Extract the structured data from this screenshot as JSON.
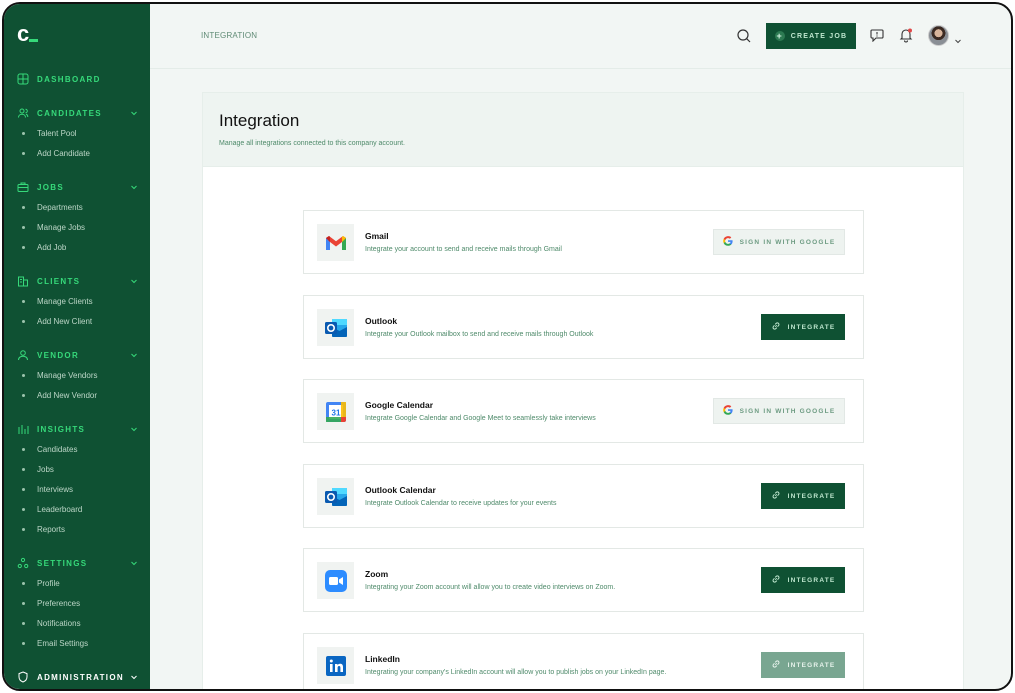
{
  "brand": {
    "logo_text": "c"
  },
  "sidebar": {
    "sections": [
      {
        "label": "DASHBOARD",
        "icon": "dashboard-icon",
        "items": []
      },
      {
        "label": "CANDIDATES",
        "icon": "candidates-icon",
        "items": [
          "Talent Pool",
          "Add Candidate"
        ]
      },
      {
        "label": "JOBS",
        "icon": "briefcase-icon",
        "items": [
          "Departments",
          "Manage Jobs",
          "Add Job"
        ]
      },
      {
        "label": "CLIENTS",
        "icon": "building-icon",
        "items": [
          "Manage Clients",
          "Add New Client"
        ]
      },
      {
        "label": "VENDOR",
        "icon": "vendor-icon",
        "items": [
          "Manage Vendors",
          "Add New Vendor"
        ]
      },
      {
        "label": "INSIGHTS",
        "icon": "bar-chart-icon",
        "items": [
          "Candidates",
          "Jobs",
          "Interviews",
          "Leaderboard",
          "Reports"
        ]
      },
      {
        "label": "SETTINGS",
        "icon": "settings-icon",
        "items": [
          "Profile",
          "Preferences",
          "Notifications",
          "Email Settings"
        ]
      },
      {
        "label": "ADMINISTRATION",
        "icon": "admin-icon",
        "items": []
      }
    ]
  },
  "topbar": {
    "breadcrumb": "INTEGRATION",
    "create_job_label": "CREATE JOB"
  },
  "page": {
    "title": "Integration",
    "subtitle": "Manage all integrations connected to this company account."
  },
  "integrations": [
    {
      "name": "Gmail",
      "description": "Integrate your account to send and receive mails through Gmail",
      "logo": "gmail-logo",
      "action": "SIGN IN WITH GOOGLE",
      "action_type": "google"
    },
    {
      "name": "Outlook",
      "description": "Integrate your Outlook mailbox to send and receive mails through Outlook",
      "logo": "outlook-logo",
      "action": "INTEGRATE",
      "action_type": "integrate"
    },
    {
      "name": "Google Calendar",
      "description": "Integrate Google Calendar and Google Meet to seamlessly take interviews",
      "logo": "google-calendar-logo",
      "action": "SIGN IN WITH GOOGLE",
      "action_type": "google"
    },
    {
      "name": "Outlook Calendar",
      "description": "Integrate Outlook Calendar to receive updates for your events",
      "logo": "outlook-logo",
      "action": "INTEGRATE",
      "action_type": "integrate"
    },
    {
      "name": "Zoom",
      "description": "Integrating your Zoom account will allow you to create video interviews on Zoom.",
      "logo": "zoom-logo",
      "action": "INTEGRATE",
      "action_type": "integrate"
    },
    {
      "name": "LinkedIn",
      "description": "Integrating your company's LinkedIn account will allow you to publish jobs on your LinkedIn page.",
      "logo": "linkedin-logo",
      "action": "INTEGRATE",
      "action_type": "integrate-disabled"
    }
  ],
  "calendar_day": "31",
  "colors": {
    "sidebar_bg": "#0f5133",
    "accent": "#36d97a",
    "muted_text": "#4e8a6a"
  }
}
